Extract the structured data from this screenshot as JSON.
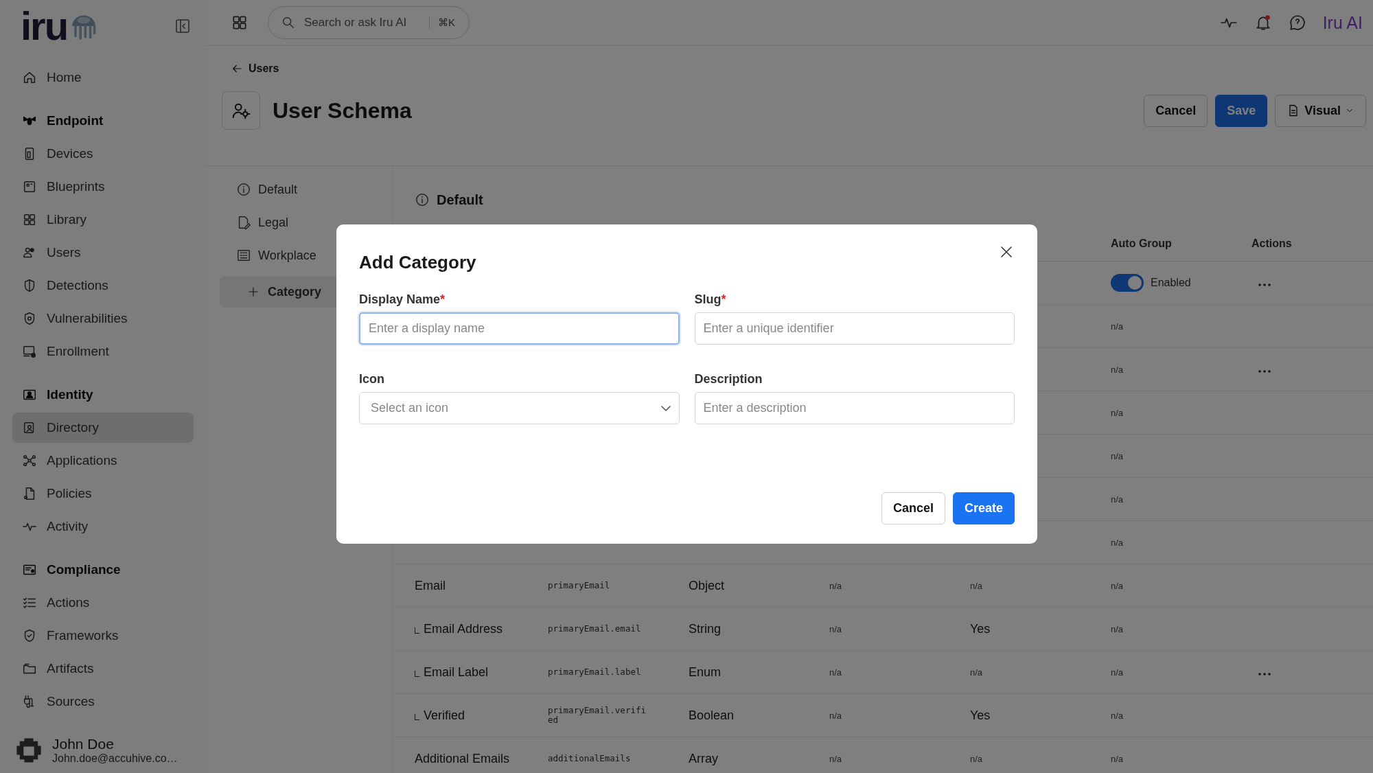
{
  "sidebar": {
    "logo": "iru",
    "items": [
      {
        "kind": "link",
        "label": "Home",
        "selected": false
      },
      {
        "kind": "section",
        "label": "Endpoint",
        "selected": false
      },
      {
        "kind": "link",
        "label": "Devices",
        "selected": false
      },
      {
        "kind": "link",
        "label": "Blueprints",
        "selected": false
      },
      {
        "kind": "link",
        "label": "Library",
        "selected": false
      },
      {
        "kind": "link",
        "label": "Users",
        "selected": false
      },
      {
        "kind": "link",
        "label": "Detections",
        "selected": false
      },
      {
        "kind": "link",
        "label": "Vulnerabilities",
        "selected": false
      },
      {
        "kind": "link",
        "label": "Enrollment",
        "selected": false
      },
      {
        "kind": "section",
        "label": "Identity",
        "selected": false
      },
      {
        "kind": "link",
        "label": "Directory",
        "selected": true
      },
      {
        "kind": "link",
        "label": "Applications",
        "selected": false
      },
      {
        "kind": "link",
        "label": "Policies",
        "selected": false
      },
      {
        "kind": "link",
        "label": "Activity",
        "selected": false
      },
      {
        "kind": "section",
        "label": "Compliance",
        "selected": false
      },
      {
        "kind": "link",
        "label": "Actions",
        "selected": false
      },
      {
        "kind": "link",
        "label": "Frameworks",
        "selected": false
      },
      {
        "kind": "link",
        "label": "Artifacts",
        "selected": false
      },
      {
        "kind": "link",
        "label": "Sources",
        "selected": false
      }
    ],
    "user": {
      "name": "John Doe",
      "email": "John.doe@accuhive.co…"
    }
  },
  "topbar": {
    "search": {
      "placeholder": "Search or ask Iru AI",
      "shortcut": "⌘K"
    },
    "assistant": "Iru AI",
    "notification": true
  },
  "breadcrumb": "Users",
  "page": {
    "title": "User Schema",
    "buttons": {
      "cancel": "Cancel",
      "save": "Save",
      "view": "Visual"
    }
  },
  "categories": [
    {
      "label": "Default",
      "selected": false
    },
    {
      "label": "Legal",
      "selected": false
    },
    {
      "label": "Workplace",
      "selected": false
    }
  ],
  "add_category": "Category",
  "section_title": "Default",
  "table": {
    "columns": [
      {
        "label": "Auto Group"
      },
      {
        "label": "Actions"
      }
    ],
    "rows": [
      {
        "toggle": {
          "on": true,
          "label": "Enabled"
        },
        "menu": true
      },
      {
        "col6": "n/a",
        "menu": false
      },
      {
        "col6": "n/a",
        "menu": true
      },
      {
        "col6": "n/a",
        "menu": false
      },
      {
        "col6": "n/a",
        "menu": false
      },
      {
        "col6": "n/a",
        "menu": false
      },
      {
        "col6": "n/a",
        "menu": false
      },
      {
        "name": "Email",
        "path": "primaryEmail",
        "type": "Object",
        "col4": {
          "text": "n/a",
          "large": false
        },
        "col5": {
          "text": "n/a",
          "large": false
        },
        "col6": "n/a",
        "menu": false,
        "children": [
          {
            "name": "Email Address",
            "path": "primaryEmail.email",
            "type": "String",
            "col4": {
              "text": "n/a",
              "large": false
            },
            "col5": {
              "text": "Yes",
              "large": true
            },
            "col6": "n/a",
            "menu": false
          },
          {
            "name": "Email Label",
            "path": "primaryEmail.label",
            "type": "Enum",
            "col4": {
              "text": "n/a",
              "large": false
            },
            "col5": {
              "text": "n/a",
              "large": false
            },
            "col6": "n/a",
            "menu": true
          },
          {
            "name": "Verified",
            "path": "primaryEmail.verified",
            "type": "Boolean",
            "col4": {
              "text": "n/a",
              "large": false
            },
            "col5": {
              "text": "Yes",
              "large": true
            },
            "col6": "n/a",
            "menu": false
          }
        ]
      },
      {
        "name": "Additional Emails",
        "path": "additionalEmails",
        "type": "Array",
        "col4": {
          "text": "n/a",
          "large": false
        },
        "col5": {
          "text": "n/a",
          "large": false
        },
        "col6": "n/a",
        "menu": false
      }
    ]
  },
  "dialog": {
    "title": "Add Category",
    "fields": [
      {
        "kind": "text",
        "label": "Display Name",
        "required": true,
        "placeholder": "Enter a display name",
        "focused": true
      },
      {
        "kind": "text",
        "label": "Slug",
        "required": true,
        "placeholder": "Enter a unique identifier",
        "focused": false
      },
      {
        "kind": "select",
        "label": "Icon",
        "required": false,
        "placeholder": "Select an icon",
        "focused": false
      },
      {
        "kind": "text",
        "label": "Description",
        "required": false,
        "placeholder": "Enter a description",
        "focused": false
      }
    ],
    "required_mark": "*",
    "buttons": {
      "cancel": "Cancel",
      "create": "Create"
    }
  }
}
